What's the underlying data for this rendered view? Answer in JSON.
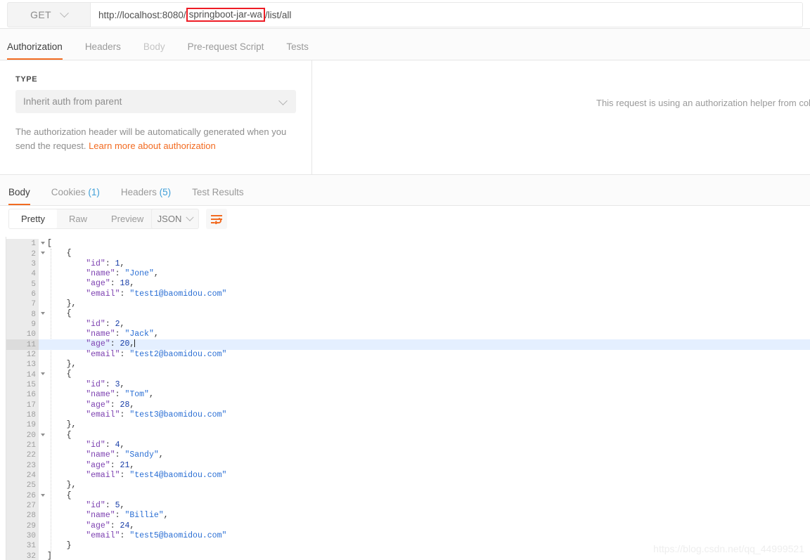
{
  "request_bar": {
    "method": "GET",
    "method_caret_icon": "chevron-down-icon",
    "url_prefix": "http://localhost:8080/",
    "url_highlighted": "springboot-jar-wa",
    "url_suffix": "/list/all",
    "highlight_color": "#ee1c25"
  },
  "request_tabs": [
    {
      "label": "Authorization",
      "state": "active"
    },
    {
      "label": "Headers",
      "state": "normal"
    },
    {
      "label": "Body",
      "state": "dim"
    },
    {
      "label": "Pre-request Script",
      "state": "normal"
    },
    {
      "label": "Tests",
      "state": "normal"
    }
  ],
  "auth_panel": {
    "type_label": "TYPE",
    "type_value": "Inherit auth from parent",
    "type_caret_icon": "chevron-down-icon",
    "description": "The authorization header will be automatically generated when you send the request. ",
    "link_text": "Learn more about authorization",
    "helper_text": "This request is using an authorization helper from colle"
  },
  "response_tabs": [
    {
      "label": "Body",
      "count": "",
      "state": "active"
    },
    {
      "label": "Cookies",
      "count": "(1)",
      "state": "normal"
    },
    {
      "label": "Headers",
      "count": "(5)",
      "state": "normal"
    },
    {
      "label": "Test Results",
      "count": "",
      "state": "normal"
    }
  ],
  "format_bar": {
    "segments": [
      {
        "label": "Pretty",
        "state": "active"
      },
      {
        "label": "Raw",
        "state": "normal"
      },
      {
        "label": "Preview",
        "state": "normal"
      }
    ],
    "language": "JSON",
    "language_caret_icon": "chevron-down-icon",
    "wrap_icon": "word-wrap-icon",
    "wrap_icon_color": "#f26b21"
  },
  "response_body": {
    "accent_highlight_line": 11,
    "lines": [
      {
        "n": 1,
        "fold": true,
        "indent": 0,
        "tokens": [
          {
            "t": "pun",
            "v": "["
          }
        ]
      },
      {
        "n": 2,
        "fold": true,
        "indent": 1,
        "tokens": [
          {
            "t": "pun",
            "v": "{"
          }
        ]
      },
      {
        "n": 3,
        "fold": false,
        "indent": 2,
        "tokens": [
          {
            "t": "key",
            "v": "\"id\""
          },
          {
            "t": "pun",
            "v": ": "
          },
          {
            "t": "num",
            "v": "1"
          },
          {
            "t": "pun",
            "v": ","
          }
        ]
      },
      {
        "n": 4,
        "fold": false,
        "indent": 2,
        "tokens": [
          {
            "t": "key",
            "v": "\"name\""
          },
          {
            "t": "pun",
            "v": ": "
          },
          {
            "t": "str",
            "v": "\"Jone\""
          },
          {
            "t": "pun",
            "v": ","
          }
        ]
      },
      {
        "n": 5,
        "fold": false,
        "indent": 2,
        "tokens": [
          {
            "t": "key",
            "v": "\"age\""
          },
          {
            "t": "pun",
            "v": ": "
          },
          {
            "t": "num",
            "v": "18"
          },
          {
            "t": "pun",
            "v": ","
          }
        ]
      },
      {
        "n": 6,
        "fold": false,
        "indent": 2,
        "tokens": [
          {
            "t": "key",
            "v": "\"email\""
          },
          {
            "t": "pun",
            "v": ": "
          },
          {
            "t": "str",
            "v": "\"test1@baomidou.com\""
          }
        ]
      },
      {
        "n": 7,
        "fold": false,
        "indent": 1,
        "tokens": [
          {
            "t": "pun",
            "v": "},"
          }
        ]
      },
      {
        "n": 8,
        "fold": true,
        "indent": 1,
        "tokens": [
          {
            "t": "pun",
            "v": "{"
          }
        ]
      },
      {
        "n": 9,
        "fold": false,
        "indent": 2,
        "tokens": [
          {
            "t": "key",
            "v": "\"id\""
          },
          {
            "t": "pun",
            "v": ": "
          },
          {
            "t": "num",
            "v": "2"
          },
          {
            "t": "pun",
            "v": ","
          }
        ]
      },
      {
        "n": 10,
        "fold": false,
        "indent": 2,
        "tokens": [
          {
            "t": "key",
            "v": "\"name\""
          },
          {
            "t": "pun",
            "v": ": "
          },
          {
            "t": "str",
            "v": "\"Jack\""
          },
          {
            "t": "pun",
            "v": ","
          }
        ]
      },
      {
        "n": 11,
        "fold": false,
        "indent": 2,
        "cursor": true,
        "tokens": [
          {
            "t": "key",
            "v": "\"age\""
          },
          {
            "t": "pun",
            "v": ": "
          },
          {
            "t": "num",
            "v": "20"
          },
          {
            "t": "pun",
            "v": ","
          }
        ]
      },
      {
        "n": 12,
        "fold": false,
        "indent": 2,
        "tokens": [
          {
            "t": "key",
            "v": "\"email\""
          },
          {
            "t": "pun",
            "v": ": "
          },
          {
            "t": "str",
            "v": "\"test2@baomidou.com\""
          }
        ]
      },
      {
        "n": 13,
        "fold": false,
        "indent": 1,
        "tokens": [
          {
            "t": "pun",
            "v": "},"
          }
        ]
      },
      {
        "n": 14,
        "fold": true,
        "indent": 1,
        "tokens": [
          {
            "t": "pun",
            "v": "{"
          }
        ]
      },
      {
        "n": 15,
        "fold": false,
        "indent": 2,
        "tokens": [
          {
            "t": "key",
            "v": "\"id\""
          },
          {
            "t": "pun",
            "v": ": "
          },
          {
            "t": "num",
            "v": "3"
          },
          {
            "t": "pun",
            "v": ","
          }
        ]
      },
      {
        "n": 16,
        "fold": false,
        "indent": 2,
        "tokens": [
          {
            "t": "key",
            "v": "\"name\""
          },
          {
            "t": "pun",
            "v": ": "
          },
          {
            "t": "str",
            "v": "\"Tom\""
          },
          {
            "t": "pun",
            "v": ","
          }
        ]
      },
      {
        "n": 17,
        "fold": false,
        "indent": 2,
        "tokens": [
          {
            "t": "key",
            "v": "\"age\""
          },
          {
            "t": "pun",
            "v": ": "
          },
          {
            "t": "num",
            "v": "28"
          },
          {
            "t": "pun",
            "v": ","
          }
        ]
      },
      {
        "n": 18,
        "fold": false,
        "indent": 2,
        "tokens": [
          {
            "t": "key",
            "v": "\"email\""
          },
          {
            "t": "pun",
            "v": ": "
          },
          {
            "t": "str",
            "v": "\"test3@baomidou.com\""
          }
        ]
      },
      {
        "n": 19,
        "fold": false,
        "indent": 1,
        "tokens": [
          {
            "t": "pun",
            "v": "},"
          }
        ]
      },
      {
        "n": 20,
        "fold": true,
        "indent": 1,
        "tokens": [
          {
            "t": "pun",
            "v": "{"
          }
        ]
      },
      {
        "n": 21,
        "fold": false,
        "indent": 2,
        "tokens": [
          {
            "t": "key",
            "v": "\"id\""
          },
          {
            "t": "pun",
            "v": ": "
          },
          {
            "t": "num",
            "v": "4"
          },
          {
            "t": "pun",
            "v": ","
          }
        ]
      },
      {
        "n": 22,
        "fold": false,
        "indent": 2,
        "tokens": [
          {
            "t": "key",
            "v": "\"name\""
          },
          {
            "t": "pun",
            "v": ": "
          },
          {
            "t": "str",
            "v": "\"Sandy\""
          },
          {
            "t": "pun",
            "v": ","
          }
        ]
      },
      {
        "n": 23,
        "fold": false,
        "indent": 2,
        "tokens": [
          {
            "t": "key",
            "v": "\"age\""
          },
          {
            "t": "pun",
            "v": ": "
          },
          {
            "t": "num",
            "v": "21"
          },
          {
            "t": "pun",
            "v": ","
          }
        ]
      },
      {
        "n": 24,
        "fold": false,
        "indent": 2,
        "tokens": [
          {
            "t": "key",
            "v": "\"email\""
          },
          {
            "t": "pun",
            "v": ": "
          },
          {
            "t": "str",
            "v": "\"test4@baomidou.com\""
          }
        ]
      },
      {
        "n": 25,
        "fold": false,
        "indent": 1,
        "tokens": [
          {
            "t": "pun",
            "v": "},"
          }
        ]
      },
      {
        "n": 26,
        "fold": true,
        "indent": 1,
        "tokens": [
          {
            "t": "pun",
            "v": "{"
          }
        ]
      },
      {
        "n": 27,
        "fold": false,
        "indent": 2,
        "tokens": [
          {
            "t": "key",
            "v": "\"id\""
          },
          {
            "t": "pun",
            "v": ": "
          },
          {
            "t": "num",
            "v": "5"
          },
          {
            "t": "pun",
            "v": ","
          }
        ]
      },
      {
        "n": 28,
        "fold": false,
        "indent": 2,
        "tokens": [
          {
            "t": "key",
            "v": "\"name\""
          },
          {
            "t": "pun",
            "v": ": "
          },
          {
            "t": "str",
            "v": "\"Billie\""
          },
          {
            "t": "pun",
            "v": ","
          }
        ]
      },
      {
        "n": 29,
        "fold": false,
        "indent": 2,
        "tokens": [
          {
            "t": "key",
            "v": "\"age\""
          },
          {
            "t": "pun",
            "v": ": "
          },
          {
            "t": "num",
            "v": "24"
          },
          {
            "t": "pun",
            "v": ","
          }
        ]
      },
      {
        "n": 30,
        "fold": false,
        "indent": 2,
        "tokens": [
          {
            "t": "key",
            "v": "\"email\""
          },
          {
            "t": "pun",
            "v": ": "
          },
          {
            "t": "str",
            "v": "\"test5@baomidou.com\""
          }
        ]
      },
      {
        "n": 31,
        "fold": false,
        "indent": 1,
        "tokens": [
          {
            "t": "pun",
            "v": "}"
          }
        ]
      },
      {
        "n": 32,
        "fold": false,
        "indent": 0,
        "tokens": [
          {
            "t": "pun",
            "v": "]"
          }
        ]
      }
    ]
  },
  "watermark": "https://blog.csdn.net/qq_44999521"
}
